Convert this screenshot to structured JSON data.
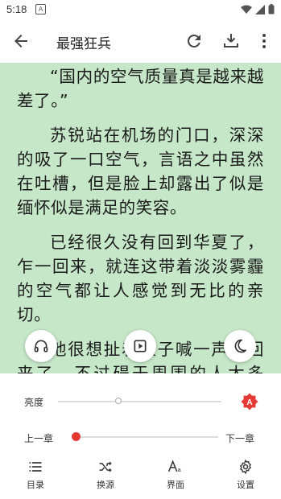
{
  "status_bar": {
    "time": "5:18",
    "notification_letter": "A"
  },
  "app_bar": {
    "title": "最强狂兵"
  },
  "content": {
    "paragraphs": [
      "“国内的空气质量真是越来越差了。”",
      "苏锐站在机场的门口，深深的吸了一口空气，言语之中虽然在吐槽，但是脸上却露出了似是缅怀似是满足的笑容。",
      "已经很久没有回到华夏了，乍一回来，就连这带着淡淡雾霾的空气都让人感觉到无比的亲切。",
      "他很想扯着嗓子喊一声我回来了，不过碍于周围的人太多了，苏锐还不想被人"
    ]
  },
  "panel": {
    "brightness_label": "亮度",
    "brightness_value": 0.37,
    "auto_brightness_letter": "A",
    "prev_chapter": "上一章",
    "next_chapter": "下一章",
    "chapter_progress": 0.0,
    "accent_color": "#e53935",
    "tabs": [
      {
        "label": "目录",
        "icon": "list-icon"
      },
      {
        "label": "换源",
        "icon": "shuffle-icon"
      },
      {
        "label": "界面",
        "icon": "font-icon"
      },
      {
        "label": "设置",
        "icon": "gear-icon"
      }
    ]
  },
  "colors": {
    "reading_background": "#c6e7c8"
  }
}
